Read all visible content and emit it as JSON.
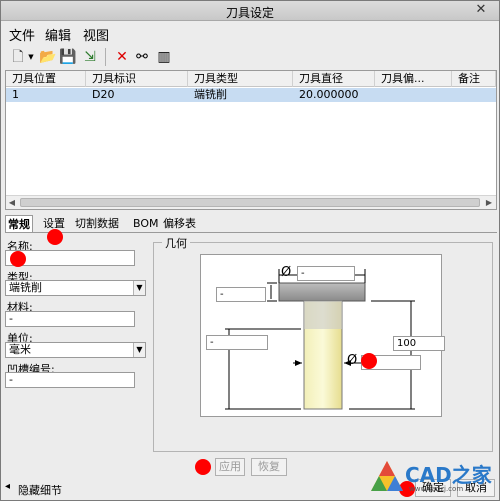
{
  "window": {
    "title": "刀具设定"
  },
  "menu": [
    "文件",
    "编辑",
    "视图"
  ],
  "toolbar_icons": [
    "new-file-icon",
    "dropdown-arrow-icon",
    "open-folder-icon",
    "save-icon",
    "export-icon",
    "delete-icon",
    "glasses-icon",
    "table-columns-icon"
  ],
  "table": {
    "columns": [
      "刀具位置",
      "刀具标识",
      "刀具类型",
      "刀具直径",
      "刀具偏...",
      "备注"
    ],
    "rows": [
      [
        "1",
        "D20",
        "端铣削",
        "20.000000",
        "",
        ""
      ]
    ]
  },
  "tabs": [
    "常规",
    "设置",
    "切割数据",
    "BOM",
    "偏移表"
  ],
  "form": {
    "name_label": "名称:",
    "name_value": "",
    "type_label": "类型:",
    "type_value": "端铣削",
    "material_label": "材料:",
    "material_value": "-",
    "unit_label": "单位:",
    "unit_value": "毫米",
    "groove_label": "凹槽编号:",
    "groove_value": "-"
  },
  "geometry": {
    "title": "几何",
    "diameter_symbol": "Ø",
    "top_diameter": "-",
    "flange_height": "-",
    "cutting_length": "-",
    "total_length": "100",
    "cutter_diameter": "-"
  },
  "buttons": {
    "apply": "应用",
    "restore": "恢复",
    "ok": "确定",
    "cancel": "取消"
  },
  "status": {
    "hide_details": "隐藏细节"
  },
  "watermark": {
    "text": "CAD之家",
    "sub": "www.cadzj.com"
  }
}
